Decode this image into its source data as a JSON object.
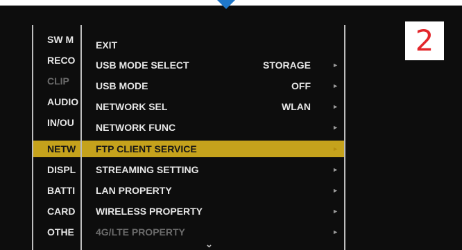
{
  "left_menu": [
    {
      "label": "SW M"
    },
    {
      "label": "RECO"
    },
    {
      "label": "CLIP"
    },
    {
      "label": "AUDIO"
    },
    {
      "label": "IN/OU"
    },
    {
      "label": "NETW"
    },
    {
      "label": "DISPL"
    },
    {
      "label": "BATTI"
    },
    {
      "label": "CARD"
    },
    {
      "label": "OTHE"
    }
  ],
  "submenu": [
    {
      "label": "EXIT",
      "value": "",
      "arrow": ""
    },
    {
      "label": "USB MODE SELECT",
      "value": "STORAGE",
      "arrow": "►"
    },
    {
      "label": "USB MODE",
      "value": "OFF",
      "arrow": "►"
    },
    {
      "label": "NETWORK SEL",
      "value": "WLAN",
      "arrow": "►"
    },
    {
      "label": "NETWORK FUNC",
      "value": "",
      "arrow": "►"
    },
    {
      "label": "FTP CLIENT SERVICE",
      "value": "",
      "arrow": "►"
    },
    {
      "label": "STREAMING SETTING",
      "value": "",
      "arrow": "►"
    },
    {
      "label": "LAN PROPERTY",
      "value": "",
      "arrow": "►"
    },
    {
      "label": "WIRELESS PROPERTY",
      "value": "",
      "arrow": "►"
    },
    {
      "label": "4G/LTE PROPERTY",
      "value": "",
      "arrow": "►"
    }
  ],
  "selected_index": 5,
  "more_indicator": "⌄",
  "step_number": "2",
  "colors": {
    "highlight": "#c5a21c",
    "marker": "#1f77c9",
    "badge_text": "#e3262b"
  }
}
